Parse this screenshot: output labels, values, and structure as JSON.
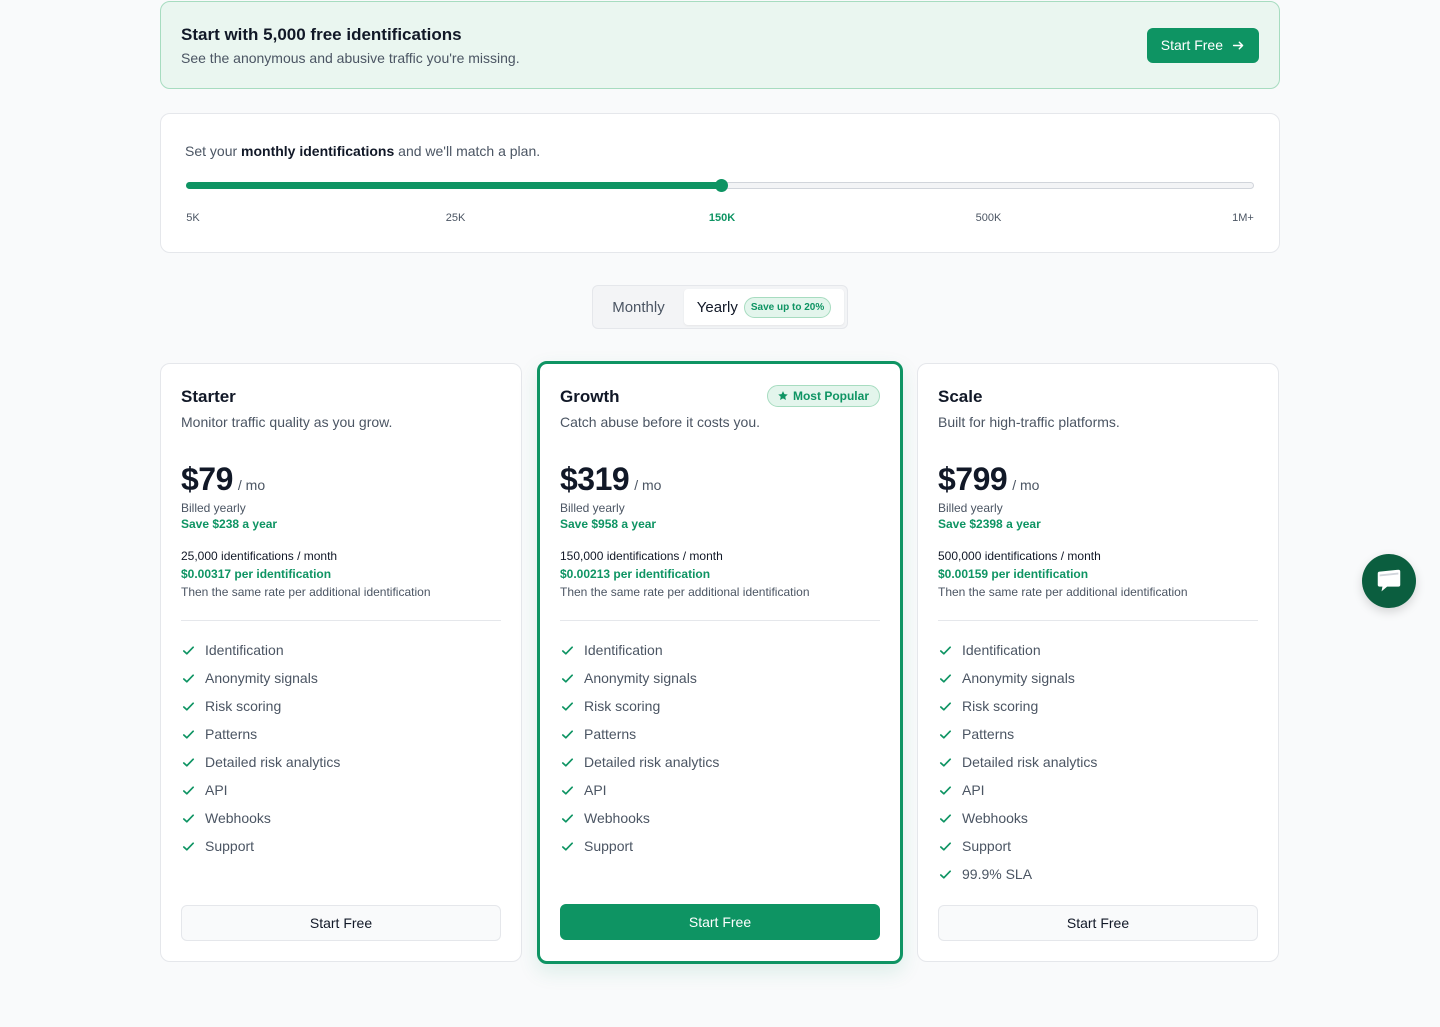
{
  "banner": {
    "title": "Start with 5,000 free identifications",
    "subtitle": "See the anonymous and abusive traffic you're missing.",
    "button_label": "Start Free",
    "button_icon": "arrow-right-icon"
  },
  "slider": {
    "prompt_prefix": "Set your",
    "prompt_bold": "monthly identifications",
    "prompt_suffix": "and we'll match a plan.",
    "ticks": [
      "5K",
      "25K",
      "150K",
      "500K",
      "1M+"
    ],
    "selected_tick": "150K",
    "value_fraction": 0.5
  },
  "billing_toggle": {
    "monthly_label": "Monthly",
    "yearly_label": "Yearly",
    "yearly_badge": "Save up to 20%",
    "selected": "Yearly"
  },
  "plans": [
    {
      "name": "Starter",
      "description": "Monitor traffic quality as you grow.",
      "price": "$79",
      "per": "/ mo",
      "billed": "Billed yearly",
      "savings": "Save $238 a year",
      "quota": "25,000 identifications / month",
      "rate": "$0.00317 per identification",
      "rate_note": "Then the same rate per additional identification",
      "features": [
        "Identification",
        "Anonymity signals",
        "Risk scoring",
        "Patterns",
        "Detailed risk analytics",
        "API",
        "Webhooks",
        "Support"
      ],
      "button_label": "Start Free"
    },
    {
      "name": "Growth",
      "badge": "Most Popular",
      "badge_icon": "star-icon",
      "description": "Catch abuse before it costs you.",
      "price": "$319",
      "per": "/ mo",
      "billed": "Billed yearly",
      "savings": "Save $958 a year",
      "quota": "150,000 identifications / month",
      "rate": "$0.00213 per identification",
      "rate_note": "Then the same rate per additional identification",
      "features": [
        "Identification",
        "Anonymity signals",
        "Risk scoring",
        "Patterns",
        "Detailed risk analytics",
        "API",
        "Webhooks",
        "Support"
      ],
      "button_label": "Start Free"
    },
    {
      "name": "Scale",
      "description": "Built for high-traffic platforms.",
      "price": "$799",
      "per": "/ mo",
      "billed": "Billed yearly",
      "savings": "Save $2398 a year",
      "quota": "500,000 identifications / month",
      "rate": "$0.00159 per identification",
      "rate_note": "Then the same rate per additional identification",
      "features": [
        "Identification",
        "Anonymity signals",
        "Risk scoring",
        "Patterns",
        "Detailed risk analytics",
        "API",
        "Webhooks",
        "Support",
        "99.9% SLA"
      ],
      "button_label": "Start Free"
    }
  ],
  "chat": {
    "icon": "chat-bubble-icon"
  },
  "colors": {
    "accent": "#0e9463",
    "accent_dark": "#0b5e3f",
    "banner_bg": "#eaf6f0",
    "text_primary": "#111827",
    "text_secondary": "#4b5563"
  }
}
